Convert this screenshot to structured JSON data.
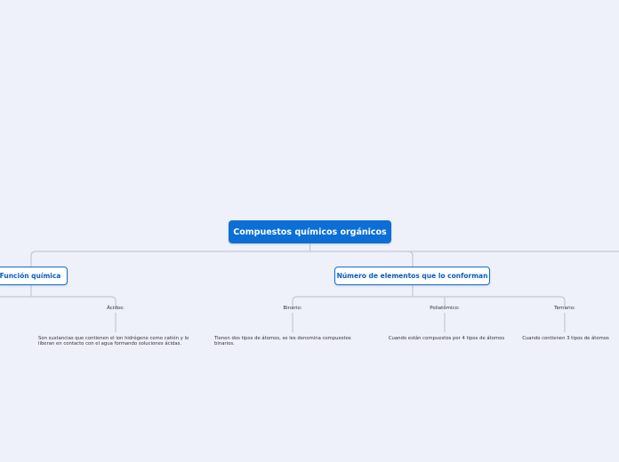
{
  "root": {
    "label": "Compuestos químicos orgánicos"
  },
  "branches": [
    {
      "label": "Función química",
      "children": [
        {
          "label": "Ácidos:",
          "description": "Son sustancias que contienen el ion hidrógeno como catión y lo liberan en contacto con el agua formando soluciones ácidas."
        }
      ]
    },
    {
      "label": "Número de elementos que lo conforman",
      "children": [
        {
          "label": "Binario:",
          "description": "Tienen dos tipos de átomos, se les denomina compuestos binarios."
        },
        {
          "label": "Poliatómico:",
          "description": "Cuando están compuestos por 4 tipos de átomos"
        },
        {
          "label": "Ternario:",
          "description": "Cuando contienen 3 tipos de átomos"
        }
      ]
    }
  ],
  "colors": {
    "background": "#eef0fa",
    "root_fill": "#0b6fd6",
    "branch_border": "#0b6fd6",
    "branch_text": "#0b5cbf",
    "connector": "#c3c8d8"
  }
}
